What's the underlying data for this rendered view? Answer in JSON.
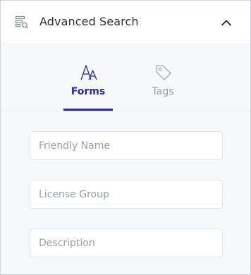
{
  "header": {
    "icon": "search-list-icon",
    "title": "Advanced Search",
    "collapse_icon": "chevron-up-icon"
  },
  "tabs": [
    {
      "label": "Forms",
      "icon": "font-icon",
      "active": true
    },
    {
      "label": "Tags",
      "icon": "tag-icon",
      "active": false
    }
  ],
  "fields": [
    {
      "placeholder": "Friendly Name",
      "value": ""
    },
    {
      "placeholder": "License Group",
      "value": ""
    },
    {
      "placeholder": "Description",
      "value": ""
    }
  ],
  "colors": {
    "accent": "#2a2a9c",
    "inactive": "#9aa0a8",
    "content_bg": "#f7f8fa",
    "border": "#e2e5ea"
  }
}
